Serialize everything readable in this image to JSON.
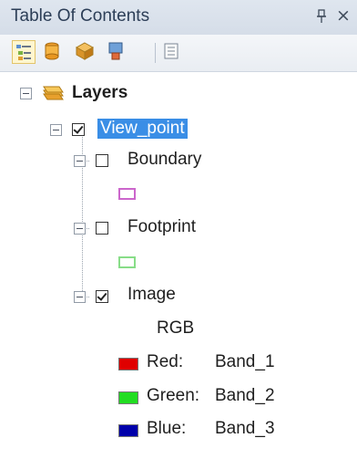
{
  "panel": {
    "title": "Table Of Contents",
    "pin_glyph": "ᵾ",
    "close_glyph": "×"
  },
  "toolbar": {
    "buttons": [
      {
        "icon": "list-by-drawing-order-icon",
        "active": true
      },
      {
        "icon": "list-by-source-icon"
      },
      {
        "icon": "list-by-visibility-icon"
      },
      {
        "icon": "list-by-selection-icon"
      },
      {
        "icon": "options-icon"
      }
    ]
  },
  "tree": {
    "root": {
      "label": "Layers",
      "icon": "layers-icon"
    },
    "group": {
      "label": "View_point",
      "checked": true,
      "selected": true
    },
    "layers": [
      {
        "label": "Boundary",
        "checked": false,
        "symbol_color": "#cc66cc"
      },
      {
        "label": "Footprint",
        "checked": false,
        "symbol_color": "#88dd88"
      },
      {
        "label": "Image",
        "checked": true
      }
    ],
    "rgb": {
      "heading": "RGB",
      "bands": [
        {
          "channel": "Red:",
          "band": "Band_1",
          "color": "#e00000"
        },
        {
          "channel": "Green:",
          "band": "Band_2",
          "color": "#22dd22"
        },
        {
          "channel": "Blue:",
          "band": "Band_3",
          "color": "#0000aa"
        }
      ]
    }
  }
}
